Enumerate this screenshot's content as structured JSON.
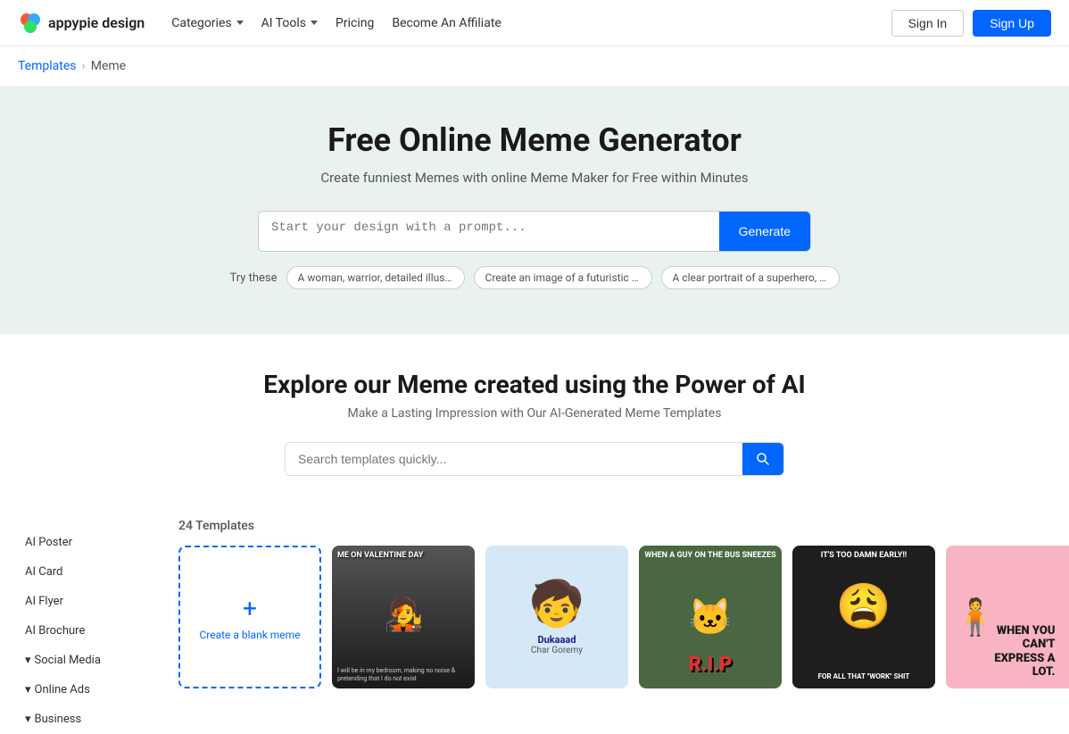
{
  "brand": {
    "name": "appypie design",
    "logo_alt": "Appypie Design Logo"
  },
  "nav": {
    "links": [
      {
        "label": "Categories",
        "has_dropdown": true
      },
      {
        "label": "AI Tools",
        "has_dropdown": true
      },
      {
        "label": "Pricing",
        "has_dropdown": false
      },
      {
        "label": "Become An Affiliate",
        "has_dropdown": false
      }
    ],
    "sign_in": "Sign In",
    "sign_up": "Sign Up"
  },
  "breadcrumb": {
    "parent": "Templates",
    "separator": "›",
    "current": "Meme"
  },
  "hero": {
    "title": "Free Online Meme Generator",
    "subtitle": "Create funniest Memes with online Meme Maker for Free within Minutes",
    "input_placeholder": "Start your design with a prompt...",
    "generate_btn": "Generate",
    "try_these_label": "Try these",
    "chips": [
      "A woman, warrior, detailed illustration, digi...",
      "Create an image of a futuristic cityscape ...",
      "A clear portrait of a superhero, backgroun..."
    ]
  },
  "explore": {
    "title": "Explore our Meme created using the Power of AI",
    "subtitle": "Make a Lasting Impression with Our AI-Generated Meme Templates",
    "search_placeholder": "Search templates quickly..."
  },
  "sidebar": {
    "items": [
      {
        "label": "AI Poster",
        "expandable": false
      },
      {
        "label": "AI Card",
        "expandable": false
      },
      {
        "label": "AI Flyer",
        "expandable": false
      },
      {
        "label": "AI Brochure",
        "expandable": false
      },
      {
        "label": "Social Media",
        "expandable": true
      },
      {
        "label": "Online Ads",
        "expandable": true
      },
      {
        "label": "Business",
        "expandable": true
      }
    ]
  },
  "templates": {
    "count": "24 Templates",
    "create_blank_label": "Create a blank meme",
    "create_plus": "+",
    "cards": [
      {
        "id": "valentine",
        "top_text": "ME ON VALENTINE DAY",
        "bottom_text": "I will be in my bedroom, making no noise & pretending that I do not exist",
        "bg_color": "#2a2a2a"
      },
      {
        "id": "dukaan",
        "label": "Dukaaad",
        "sub_label": "Char Goremy",
        "bg_color": "#c8e0f4"
      },
      {
        "id": "rip",
        "top_text": "WHEN A GUY ON THE BUS SNEEZES",
        "rip_text": "R.I.P",
        "bg_color": "#4a6741"
      },
      {
        "id": "work",
        "top_text": "IT'S TOO DAMN EARLY!!",
        "bottom_text": "FOR ALL THAT \"WORK\" SHIT",
        "bg_color": "#1a1a1a"
      },
      {
        "id": "express",
        "text": "WHEN YOU CAN'T EXPRESS A LOT.",
        "bg_color": "#f8b4c0"
      }
    ]
  },
  "icons": {
    "search": "🔍",
    "chevron_down": "▾"
  }
}
